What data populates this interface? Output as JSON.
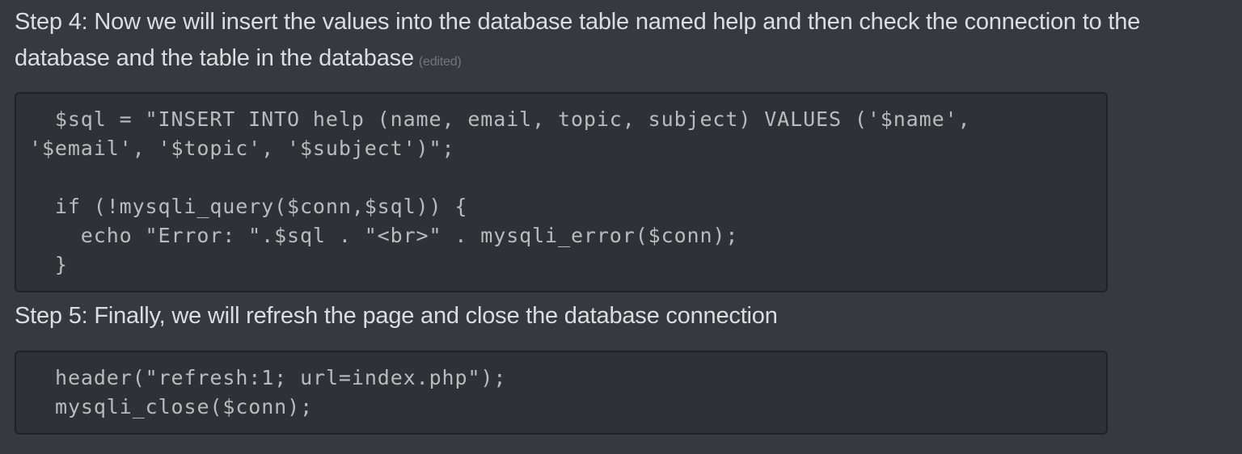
{
  "message": {
    "step4_text": "Step 4: Now we will insert the values into the database table named help and then check the connection to the database and the table in the database",
    "edited_label": "(edited)",
    "code_block_1": "  $sql = \"INSERT INTO help (name, email, topic, subject) VALUES ('$name',\n'$email', '$topic', '$subject')\";\n\n  if (!mysqli_query($conn,$sql)) {\n    echo \"Error: \".$sql . \"<br>\" . mysqli_error($conn);\n  }",
    "step5_text": "Step 5: Finally, we will refresh the page and close the database connection",
    "code_block_2": "header(\"refresh:1; url=index.php\");\nmysqli_close($conn);"
  },
  "colors": {
    "background": "#36393f",
    "code_background": "#2f3136",
    "code_border": "#202225",
    "text": "#dcddde",
    "muted": "#72767d"
  }
}
